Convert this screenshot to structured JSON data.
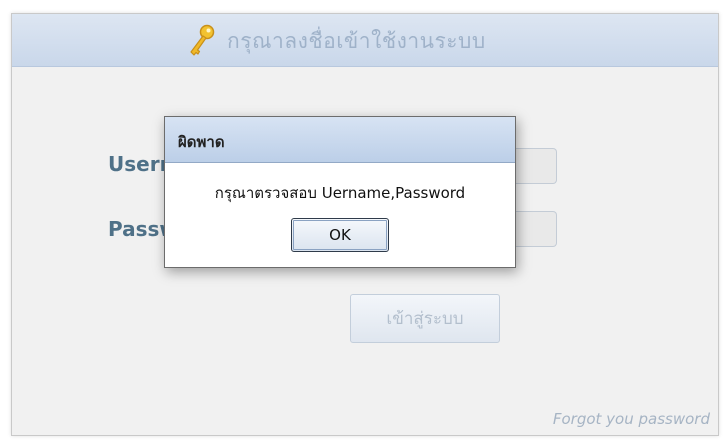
{
  "login_panel": {
    "title": "กรุณาลงชื่อเข้าใช้งานระบบ",
    "header_icon": "key-icon",
    "username_label": "Username",
    "password_label": "Password",
    "login_button_label": "เข้าสู่ระบบ",
    "forgot_link": "Forgot you password"
  },
  "error_dialog": {
    "title": "ผิดพาด",
    "message": "กรุณาตรวจสอบ Uername,Password",
    "ok_label": "OK"
  },
  "colors": {
    "header_bg": "#c9d7ea",
    "label_text": "#4f7188",
    "dialog_titlebar": "#bccfe8"
  }
}
